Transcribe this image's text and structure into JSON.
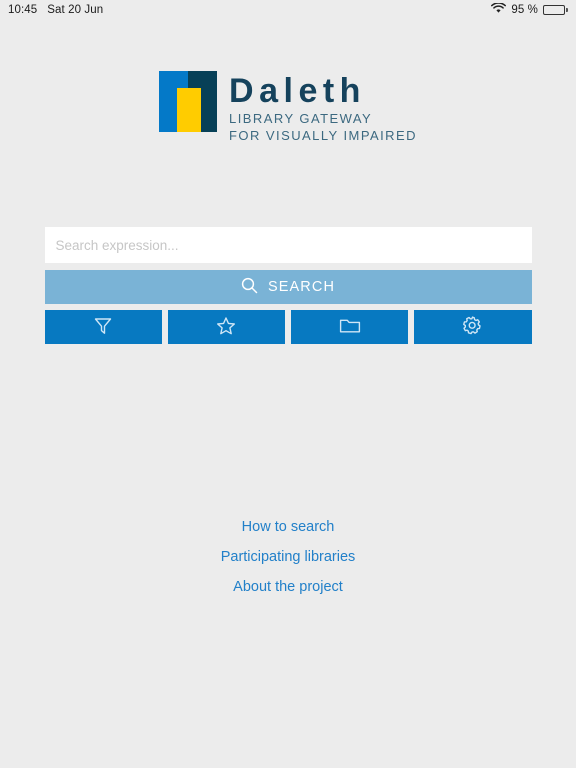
{
  "status_bar": {
    "time": "10:45",
    "date": "Sat 20 Jun",
    "wifi_icon": "wifi-icon",
    "battery_percent": "95 %",
    "battery_icon": "battery-icon"
  },
  "logo": {
    "brand": "Daleth",
    "tagline_line1": "LIBRARY GATEWAY",
    "tagline_line2": "FOR VISUALLY IMPAIRED",
    "mark_colors": {
      "blue": "#0479c8",
      "navy": "#074057",
      "yellow": "#ffcc00"
    },
    "brand_color": "#15425c",
    "tagline_color": "#3c6980"
  },
  "search": {
    "placeholder": "Search expression...",
    "value": "",
    "button_label": "SEARCH",
    "button_icon": "search-icon",
    "button_color": "#7ab3d6"
  },
  "toolbar": {
    "accent_color": "#0779c1",
    "buttons": [
      {
        "name": "filter",
        "icon": "filter-icon"
      },
      {
        "name": "favorites",
        "icon": "star-icon"
      },
      {
        "name": "folders",
        "icon": "folder-icon"
      },
      {
        "name": "settings",
        "icon": "gear-icon"
      }
    ]
  },
  "links": {
    "color": "#2280c9",
    "items": [
      {
        "label": "How to search"
      },
      {
        "label": "Participating libraries"
      },
      {
        "label": "About the project"
      }
    ]
  },
  "theme": {
    "background": "#ececec",
    "input_background": "#ffffff"
  }
}
